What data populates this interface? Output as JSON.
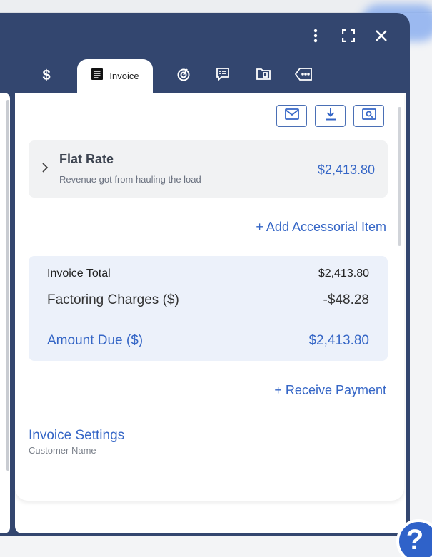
{
  "header": {
    "icons": [
      "more-vertical-icon",
      "fullscreen-icon",
      "close-icon"
    ]
  },
  "tabs": {
    "pay": "$",
    "invoice": "Invoice",
    "others": [
      "tracking-icon",
      "notes-icon",
      "documents-icon",
      "tags-icon"
    ]
  },
  "actions": [
    "email-icon",
    "download-icon",
    "preview-icon"
  ],
  "item": {
    "title": "Flat Rate",
    "subtitle": "Revenue got from hauling the load",
    "amount": "$2,413.80"
  },
  "add_accessorial": "+ Add Accessorial Item",
  "totals": {
    "invoice_total_label": "Invoice Total",
    "invoice_total_value": "$2,413.80",
    "factoring_label": "Factoring Charges ($)",
    "factoring_value": "-$48.28",
    "amount_due_label": "Amount Due ($)",
    "amount_due_value": "$2,413.80"
  },
  "receive_payment": "+ Receive Payment",
  "invoice_settings": {
    "title": "Invoice Settings",
    "customer_name_label": "Customer Name"
  },
  "help": "?",
  "colors": {
    "panel": "#33466f",
    "accent": "#3566c6",
    "totals_bg": "#ecf1fa"
  }
}
